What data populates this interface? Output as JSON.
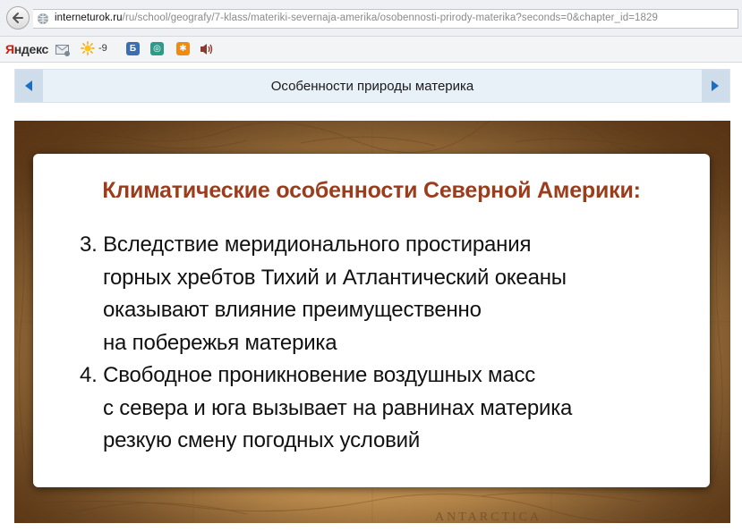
{
  "browser": {
    "url_host": "interneturok.ru",
    "url_path": "/ru/school/geografy/7-klass/materiki-severnaja-amerika/osobennosti-prirody-materika?seconds=0&chapter_id=1829"
  },
  "toolbar": {
    "logo_ya": "Я",
    "logo_rest": "ндекс",
    "temperature": "-9"
  },
  "nav": {
    "title": "Особенности природы материка"
  },
  "slide": {
    "title": "Климатические особенности Северной Америки:",
    "items": [
      {
        "lines": [
          "3. Вследствие меридионального простирания",
          "горных хребтов Тихий и Атлантический океаны",
          "оказывают влияние преимущественно",
          "на побережья материка"
        ]
      },
      {
        "lines": [
          "4. Свободное проникновение воздушных масс",
          "с севера и юга вызывает на равнинах материка",
          "резкую смену погодных условий"
        ]
      }
    ],
    "map_label": "ANTARCTICA"
  },
  "colors": {
    "title_color": "#9b3d1d",
    "nav_arrow_color": "#1a6fc4",
    "yandex_red": "#e61400"
  },
  "icons": [
    "back-arrow-icon",
    "globe-icon",
    "mail-icon",
    "sun-icon",
    "bookmark-icon",
    "music-icon",
    "sound-icon",
    "nav-left-icon",
    "nav-right-icon"
  ]
}
